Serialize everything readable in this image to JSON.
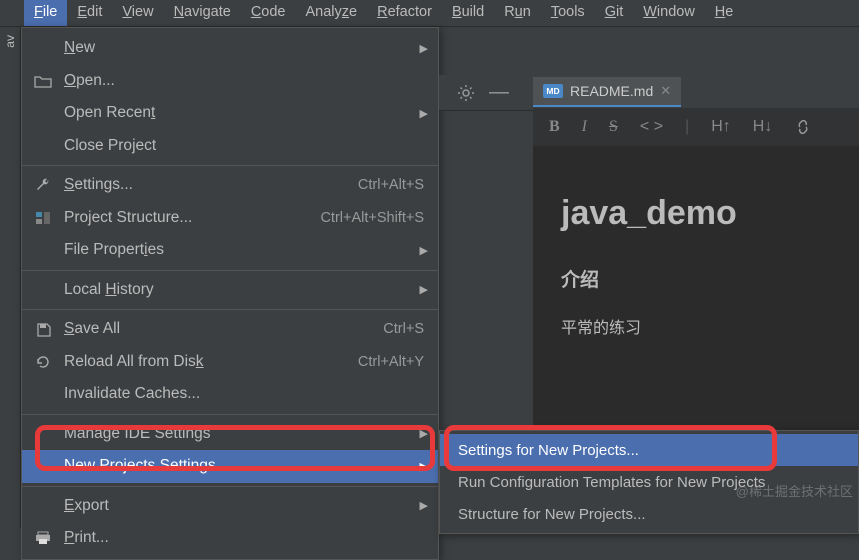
{
  "menubar": {
    "items": [
      {
        "pre": "",
        "m": "F",
        "post": "ile",
        "active": true
      },
      {
        "pre": "",
        "m": "E",
        "post": "dit",
        "active": false
      },
      {
        "pre": "",
        "m": "V",
        "post": "iew",
        "active": false
      },
      {
        "pre": "",
        "m": "N",
        "post": "avigate",
        "active": false
      },
      {
        "pre": "",
        "m": "C",
        "post": "ode",
        "active": false
      },
      {
        "pre": "Analy",
        "m": "z",
        "post": "e",
        "active": false
      },
      {
        "pre": "",
        "m": "R",
        "post": "efactor",
        "active": false
      },
      {
        "pre": "",
        "m": "B",
        "post": "uild",
        "active": false
      },
      {
        "pre": "R",
        "m": "u",
        "post": "n",
        "active": false
      },
      {
        "pre": "",
        "m": "T",
        "post": "ools",
        "active": false
      },
      {
        "pre": "",
        "m": "G",
        "post": "it",
        "active": false
      },
      {
        "pre": "",
        "m": "W",
        "post": "indow",
        "active": false
      },
      {
        "pre": "",
        "m": "H",
        "post": "e",
        "active": false
      }
    ]
  },
  "sidebar": {
    "label": "av"
  },
  "file_menu": {
    "new": {
      "pre": "",
      "m": "N",
      "post": "ew",
      "shortcut": "",
      "arrow": true,
      "icon": ""
    },
    "open": {
      "pre": "",
      "m": "O",
      "post": "pen...",
      "shortcut": "",
      "arrow": false,
      "icon": "folder"
    },
    "open_recent": {
      "pre": "Open Recen",
      "m": "t",
      "post": "",
      "shortcut": "",
      "arrow": true,
      "icon": ""
    },
    "close_project": {
      "pre": "Close Pro",
      "m": "j",
      "post": "ect",
      "shortcut": "",
      "arrow": false,
      "icon": ""
    },
    "settings": {
      "pre": "",
      "m": "S",
      "post": "ettings...",
      "shortcut": "Ctrl+Alt+S",
      "arrow": false,
      "icon": "wrench"
    },
    "project_struct": {
      "pre": "Project Structure...",
      "m": "",
      "post": "",
      "shortcut": "Ctrl+Alt+Shift+S",
      "arrow": false,
      "icon": "project"
    },
    "file_props": {
      "pre": "File Propert",
      "m": "i",
      "post": "es",
      "shortcut": "",
      "arrow": true,
      "icon": ""
    },
    "local_history": {
      "pre": "Local ",
      "m": "H",
      "post": "istory",
      "shortcut": "",
      "arrow": true,
      "icon": ""
    },
    "save_all": {
      "pre": "",
      "m": "S",
      "post": "ave All",
      "shortcut": "Ctrl+S",
      "arrow": false,
      "icon": "disk"
    },
    "reload": {
      "pre": "Reload All from Dis",
      "m": "k",
      "post": "",
      "shortcut": "Ctrl+Alt+Y",
      "arrow": false,
      "icon": "reload"
    },
    "inv_caches": {
      "pre": "Invalidate Caches...",
      "m": "",
      "post": "",
      "shortcut": "",
      "arrow": false,
      "icon": ""
    },
    "manage_ide": {
      "pre": "Manage IDE Settings",
      "m": "",
      "post": "",
      "shortcut": "",
      "arrow": true,
      "icon": ""
    },
    "new_proj": {
      "pre": "New Projects Settings",
      "m": "",
      "post": "",
      "shortcut": "",
      "arrow": true,
      "icon": "",
      "highlighted": true
    },
    "export": {
      "pre": "",
      "m": "E",
      "post": "xport",
      "shortcut": "",
      "arrow": true,
      "icon": ""
    },
    "print": {
      "pre": "",
      "m": "P",
      "post": "rint...",
      "shortcut": "",
      "arrow": false,
      "icon": "print"
    }
  },
  "submenu": {
    "items": [
      {
        "label": "Settings for New Projects...",
        "highlighted": true
      },
      {
        "label": "Run Configuration Templates for New Projects",
        "highlighted": false
      },
      {
        "label": "Structure for New Projects...",
        "highlighted": false
      }
    ]
  },
  "tabs": {
    "readme": {
      "label": "README.md",
      "icon": "MD"
    }
  },
  "md_toolbar": {
    "bold": "B",
    "italic": "I",
    "strike": "S",
    "code": "< >",
    "h_up": "H↑",
    "h_down": "H↓"
  },
  "document": {
    "title": "java_demo",
    "subtitle": "介绍",
    "body": "平常的练习"
  },
  "watermark": "@稀土掘金技术社区"
}
